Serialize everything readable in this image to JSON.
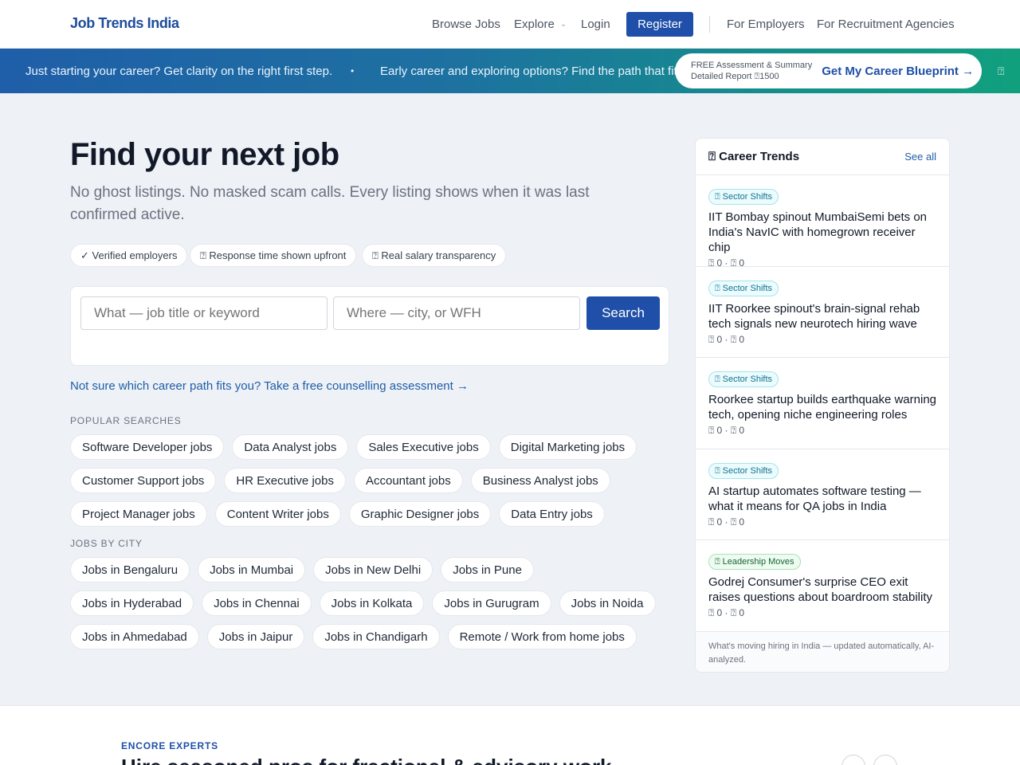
{
  "header": {
    "logo": "Job Trends India",
    "nav": {
      "browse_jobs": "Browse Jobs",
      "explore": "Explore",
      "login": "Login",
      "register": "Register",
      "for_employers": "For Employers",
      "for_agencies": "For Recruitment Agencies"
    }
  },
  "banner": {
    "text_1": "Just starting your career? Get clarity on the right first step.",
    "separator": "•",
    "text_2": "Early career and exploring options? Find the path that fits you.",
    "cta_small_line1": "FREE Assessment & Summary",
    "cta_small_line2": "Detailed Report ⍰1500",
    "cta_label": "Get My Career Blueprint →",
    "close": "⍰"
  },
  "hero": {
    "title": "Find your next job",
    "subtitle": "No ghost listings. No masked scam calls. Every listing shows when it was last confirmed active.",
    "trust_badges": [
      "✓ Verified employers",
      "⍰ Response time shown upfront",
      "⍰ Real salary transparency"
    ]
  },
  "search": {
    "what_placeholder": "What — job title or keyword",
    "where_placeholder": "Where — city, or WFH",
    "button": "Search"
  },
  "counselling_link": "Not sure which career path fits you? Take a free counselling assessment →",
  "popular": {
    "label": "POPULAR SEARCHES",
    "items": [
      "Software Developer jobs",
      "Data Analyst jobs",
      "Sales Executive jobs",
      "Digital Marketing jobs",
      "Customer Support jobs",
      "HR Executive jobs",
      "Accountant jobs",
      "Business Analyst jobs",
      "Project Manager jobs",
      "Content Writer jobs",
      "Graphic Designer jobs",
      "Data Entry jobs"
    ]
  },
  "cities": {
    "label": "JOBS BY CITY",
    "items": [
      "Jobs in Bengaluru",
      "Jobs in Mumbai",
      "Jobs in New Delhi",
      "Jobs in Pune",
      "Jobs in Hyderabad",
      "Jobs in Chennai",
      "Jobs in Kolkata",
      "Jobs in Gurugram",
      "Jobs in Noida",
      "Jobs in Ahmedabad",
      "Jobs in Jaipur",
      "Jobs in Chandigarh",
      "Remote / Work from home jobs"
    ]
  },
  "trends": {
    "title": "⍰ Career Trends",
    "see_all": "See all",
    "items": [
      {
        "tag": "⍰ Sector Shifts",
        "tag_color": "#0e7490",
        "title": "IIT Bombay spinout MumbaiSemi bets on India's NavIC with homegrown receiver chip",
        "meta": "⍰ 0 · ⍰ 0"
      },
      {
        "tag": "⍰ Sector Shifts",
        "tag_color": "#0e7490",
        "title": "IIT Roorkee spinout's brain-signal rehab tech signals new neurotech hiring wave",
        "meta": "⍰ 0 · ⍰ 0"
      },
      {
        "tag": "⍰ Sector Shifts",
        "tag_color": "#0e7490",
        "title": "Roorkee startup builds earthquake warning tech, opening niche engineering roles",
        "meta": "⍰ 0 · ⍰ 0"
      },
      {
        "tag": "⍰ Sector Shifts",
        "tag_color": "#0e7490",
        "title": "AI startup automates software testing — what it means for QA jobs in India",
        "meta": "⍰ 0 · ⍰ 0"
      },
      {
        "tag": "⍰ Leadership Moves",
        "tag_color": "#166534",
        "title": "Godrej Consumer's surprise CEO exit raises questions about boardroom stability",
        "meta": "⍰ 0 · ⍰ 0"
      }
    ],
    "footer": "What's moving hiring in India — updated automatically, AI-analyzed."
  },
  "encore": {
    "eyebrow": "ENCORE EXPERTS",
    "title": "Hire seasoned pros for fractional & advisory work"
  },
  "colors": {
    "primary": "#1f4fa8",
    "link": "#1f5ea8",
    "background": "#eef1f6"
  }
}
